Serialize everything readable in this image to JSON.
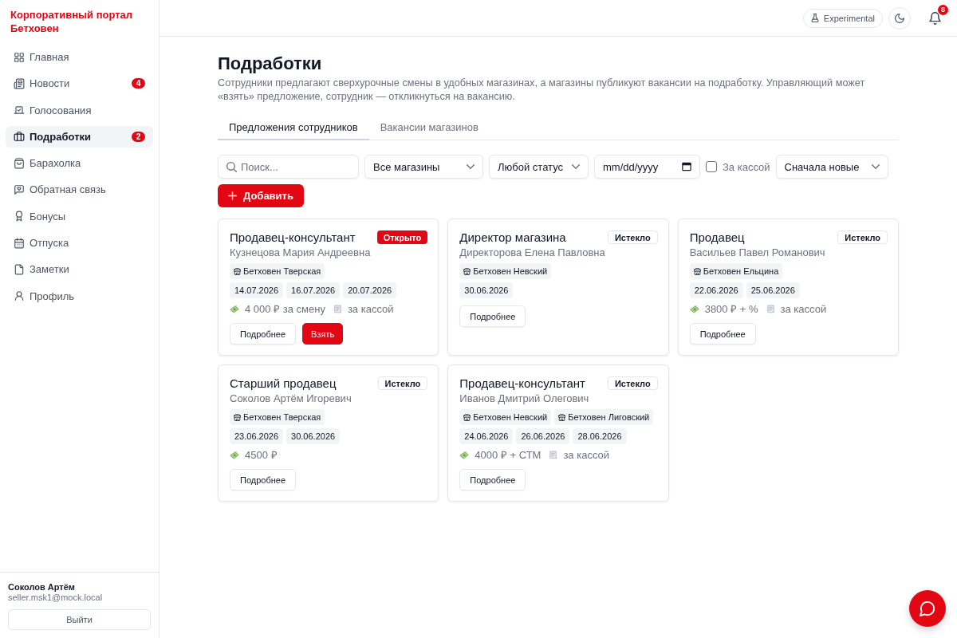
{
  "sidebar": {
    "brand": "Корпоративный портал Бетховен",
    "items": [
      {
        "label": "Главная",
        "selected": false
      },
      {
        "label": "Новости",
        "badge": "4",
        "selected": false
      },
      {
        "label": "Голосования",
        "selected": false
      },
      {
        "label": "Подработки",
        "badge": "2",
        "selected": true
      },
      {
        "label": "Барахолка",
        "selected": false
      },
      {
        "label": "Обратная связь",
        "selected": false
      },
      {
        "label": "Бонусы",
        "selected": false
      },
      {
        "label": "Отпуска",
        "selected": false
      },
      {
        "label": "Заметки",
        "selected": false
      },
      {
        "label": "Профиль",
        "selected": false
      }
    ],
    "user": {
      "name": "Соколов Артём",
      "email": "seller.msk1@mock.local"
    },
    "logout": "Выйти"
  },
  "header": {
    "experimental": "Experimental",
    "notifications": "8"
  },
  "page": {
    "title": "Подработки",
    "description": "Сотрудники предлагают сверхурочные смены в удобных магазинах, а магазины публикуют вакансии на подработку. Управляющий может «взять» предложение, сотрудник — откликнуться на вакансию."
  },
  "tabs": [
    {
      "label": "Предложения сотрудников",
      "selected": true
    },
    {
      "label": "Вакансии магазинов",
      "selected": false
    }
  ],
  "filters": {
    "search": {
      "placeholder": "Поиск..."
    },
    "store": {
      "value": "Все магазины"
    },
    "status": {
      "value": "Любой статус"
    },
    "date": {
      "placeholder": "mm/dd/yyyy"
    },
    "register_only": {
      "label": "За кассой",
      "checked": false
    },
    "sort": {
      "value": "Сначала новые"
    }
  },
  "add_button": "Добавить",
  "cards": [
    {
      "title": "Продавец-консультант",
      "status": {
        "kind": "open",
        "label": "Открыто"
      },
      "person": "Кузнецова Мария Андреевна",
      "stores": [
        "Бетховен Тверская"
      ],
      "dates": [
        "14.07.2026",
        "16.07.2026",
        "20.07.2026"
      ],
      "pay": "4 000 ₽ за смену",
      "register": "за кассой",
      "buttons": [
        {
          "kind": "secondary",
          "label": "Подробнее"
        },
        {
          "kind": "primary",
          "label": "Взять"
        }
      ]
    },
    {
      "title": "Директор магазина",
      "status": {
        "kind": "expired",
        "label": "Истекло"
      },
      "person": "Директорова Елена Павловна",
      "stores": [
        "Бетховен Невский"
      ],
      "dates": [
        "30.06.2026"
      ],
      "buttons": [
        {
          "kind": "secondary",
          "label": "Подробнее"
        }
      ]
    },
    {
      "title": "Продавец",
      "status": {
        "kind": "expired",
        "label": "Истекло"
      },
      "person": "Васильев Павел Романович",
      "stores": [
        "Бетховен Ельцина"
      ],
      "dates": [
        "22.06.2026",
        "25.06.2026"
      ],
      "pay": "3800 ₽ + %",
      "register": "за кассой",
      "buttons": [
        {
          "kind": "secondary",
          "label": "Подробнее"
        }
      ]
    },
    {
      "title": "Старший продавец",
      "status": {
        "kind": "expired",
        "label": "Истекло"
      },
      "person": "Соколов Артём Игоревич",
      "stores": [
        "Бетховен Тверская"
      ],
      "dates": [
        "23.06.2026",
        "30.06.2026"
      ],
      "pay": "4500 ₽",
      "buttons": [
        {
          "kind": "secondary",
          "label": "Подробнее"
        }
      ]
    },
    {
      "title": "Продавец-консультант",
      "status": {
        "kind": "expired",
        "label": "Истекло"
      },
      "person": "Иванов Дмитрий Олегович",
      "stores": [
        "Бетховен Невский",
        "Бетховен Лиговский"
      ],
      "dates": [
        "24.06.2026",
        "26.06.2026",
        "28.06.2026"
      ],
      "pay": "4000 ₽ + СТМ",
      "register": "за кассой",
      "buttons": [
        {
          "kind": "secondary",
          "label": "Подробнее"
        }
      ]
    }
  ]
}
